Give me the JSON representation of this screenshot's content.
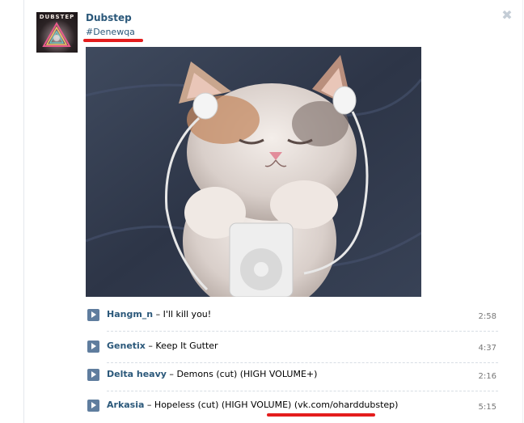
{
  "post": {
    "group_name": "Dubstep",
    "hashtag": "#Denewqa",
    "avatar_text": "DUBSTEP",
    "close_icon": "close-icon",
    "photo_icon": "photo-image"
  },
  "tracks": [
    {
      "artist": "Hangm_n",
      "title": "I'll kill you!",
      "duration": "2:58"
    },
    {
      "artist": "Genetix",
      "title": "Keep It Gutter",
      "duration": "4:37"
    },
    {
      "artist": "Delta heavy",
      "title": "Demons (cut) (HIGH VOLUME+)",
      "duration": "2:16"
    },
    {
      "artist": "Arkasia",
      "title": "Hopeless (cut) (HIGH VOLUME) (vk.com/oharddubstep)",
      "duration": "5:15"
    }
  ],
  "separator": " – ",
  "colors": {
    "link": "#2b587a",
    "play": "#5f7d9e",
    "highlight": "#e41d1d"
  }
}
